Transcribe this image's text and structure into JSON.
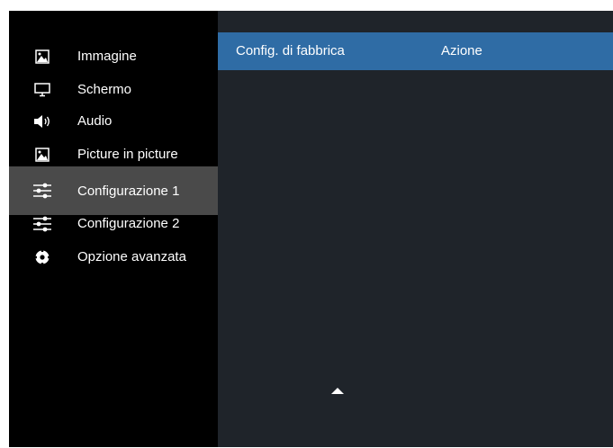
{
  "sidebar": {
    "items": [
      {
        "label": "Immagine",
        "icon": "picture-icon",
        "selected": false
      },
      {
        "label": "Schermo",
        "icon": "monitor-icon",
        "selected": false
      },
      {
        "label": "Audio",
        "icon": "speaker-icon",
        "selected": false
      },
      {
        "label": "Picture in picture",
        "icon": "picture-icon",
        "selected": false
      },
      {
        "label": "Configurazione 1",
        "icon": "sliders-icon",
        "selected": true
      },
      {
        "label": "Configurazione 2",
        "icon": "sliders-icon",
        "selected": false
      },
      {
        "label": "Opzione avanzata",
        "icon": "gear-icon",
        "selected": false
      }
    ]
  },
  "main": {
    "row": {
      "name": "Config. di fabbrica",
      "value": "Azione"
    }
  },
  "colors": {
    "selected_row": "#2f6ca5",
    "sidebar_selected": "#4a4a4a",
    "panel_bg": "#1f242a"
  }
}
